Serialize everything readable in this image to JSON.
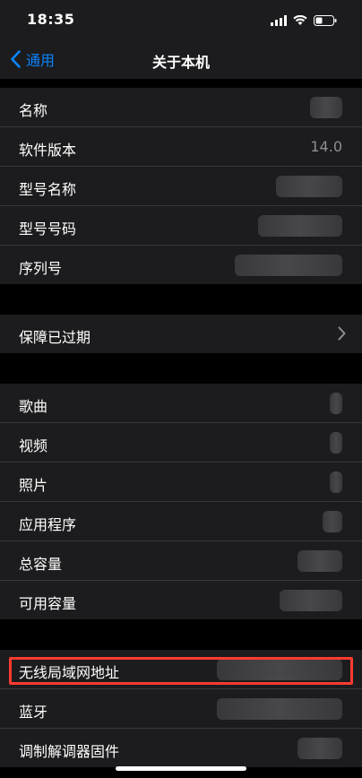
{
  "status": {
    "time": "18:35"
  },
  "nav": {
    "back_label": "通用",
    "title": "关于本机"
  },
  "sections": [
    {
      "rows": [
        {
          "label": "名称",
          "value": ""
        },
        {
          "label": "软件版本",
          "value": "14.0"
        },
        {
          "label": "型号名称",
          "value": ""
        },
        {
          "label": "型号号码",
          "value": ""
        },
        {
          "label": "序列号",
          "value": ""
        }
      ]
    },
    {
      "rows": [
        {
          "label": "保障已过期"
        }
      ]
    },
    {
      "rows": [
        {
          "label": "歌曲"
        },
        {
          "label": "视频"
        },
        {
          "label": "照片"
        },
        {
          "label": "应用程序"
        },
        {
          "label": "总容量"
        },
        {
          "label": "可用容量"
        }
      ]
    },
    {
      "rows": [
        {
          "label": "无线局域网地址"
        },
        {
          "label": "蓝牙"
        },
        {
          "label": "调制解调器固件"
        }
      ]
    }
  ],
  "colors": {
    "accent": "#0a84ff",
    "highlight": "#ff3b30",
    "row_bg": "#1c1c1e"
  },
  "icons": [
    "cellular-signal-icon",
    "wifi-icon",
    "battery-icon",
    "chevron-left-icon",
    "chevron-right-icon"
  ]
}
